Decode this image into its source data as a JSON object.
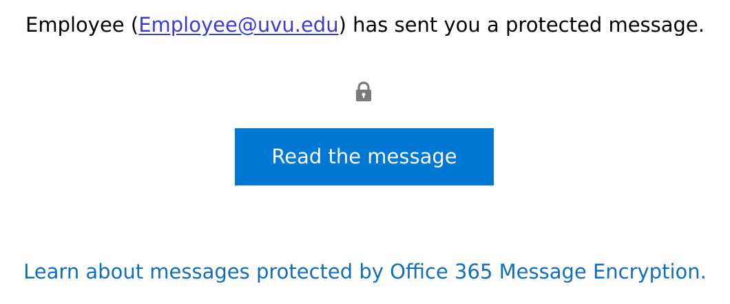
{
  "message": {
    "sender_name": "Employee",
    "open_paren": " (",
    "sender_email": "Employee@uvu.edu",
    "suffix": ") has sent you a protected message."
  },
  "lock_icon": "lock-icon",
  "read_button": {
    "label": "Read the message",
    "color": "#0078d4"
  },
  "learn_link": {
    "text": "Learn about messages protected by Office 365 Message Encryption."
  }
}
